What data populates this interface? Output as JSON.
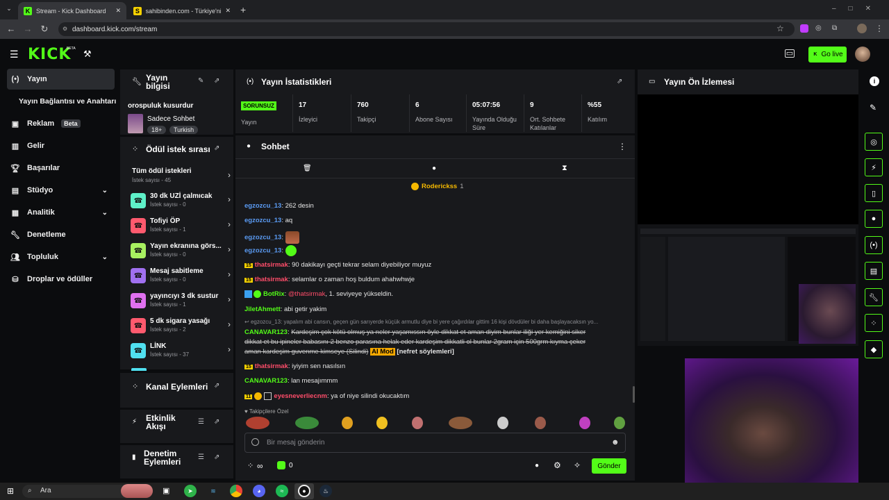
{
  "browser": {
    "tabs": [
      {
        "title": "Stream - Kick Dashboard"
      },
      {
        "title": "sahibinden.com - Türkiye'nin O"
      }
    ],
    "new_tab": "+",
    "url": "dashboard.kick.com/stream"
  },
  "header": {
    "logo": "KICK",
    "beta": "BETA",
    "go_live": "Go live"
  },
  "sidebar": {
    "items": [
      {
        "label": "Yayın",
        "icon": "broadcast-icon"
      },
      {
        "label": "Yayın Bağlantısı ve Anahtarı"
      },
      {
        "label": "Reklam",
        "badge": "Beta",
        "icon": "ad-icon"
      },
      {
        "label": "Gelir",
        "icon": "chart-icon"
      },
      {
        "label": "Başarılar",
        "icon": "trophy-icon"
      },
      {
        "label": "Stüdyo",
        "icon": "studio-icon"
      },
      {
        "label": "Analitik",
        "icon": "analytics-icon"
      },
      {
        "label": "Denetleme",
        "icon": "wrench-icon"
      },
      {
        "label": "Topluluk",
        "icon": "community-icon"
      },
      {
        "label": "Droplar ve ödüller",
        "icon": "drops-icon"
      }
    ]
  },
  "stream_info": {
    "title": "Yayın bilgisi",
    "stream_title": "orospuluk kusurdur",
    "category": "Sadece Sohbet",
    "tags": [
      "18+",
      "Turkish"
    ]
  },
  "rewards": {
    "title": "Ödül istek sırası",
    "all_title": "Tüm ödül istekleri",
    "all_count": "İstek sayısı - 45",
    "items": [
      {
        "title": "30 dk UZİ çalmıcak",
        "count": "İstek sayısı - 0",
        "color": "#5ef0c8"
      },
      {
        "title": "Tofiyi ÖP",
        "count": "İstek sayısı - 1",
        "color": "#ff5a6e"
      },
      {
        "title": "Yayın ekranına görs...",
        "count": "İstek sayısı - 0",
        "color": "#a8f060"
      },
      {
        "title": "Mesaj sabitleme",
        "count": "İstek sayısı - 0",
        "color": "#a070f0"
      },
      {
        "title": "yayıncıyı 3 dk sustur",
        "count": "İstek sayısı - 1",
        "color": "#e070f0"
      },
      {
        "title": "5 dk sigara yasağı",
        "count": "İstek sayısı - 2",
        "color": "#ff5a6e"
      },
      {
        "title": "LİNK",
        "count": "İstek sayısı - 37",
        "color": "#50e0f0"
      }
    ]
  },
  "channel_actions": {
    "title": "Kanal Eylemleri"
  },
  "activity": {
    "title": "Etkinlik Akışı"
  },
  "mod_actions": {
    "title": "Denetim Eylemleri"
  },
  "stats": {
    "title": "Yayın İstatistikleri",
    "items": [
      {
        "value": "SORUNSUZ",
        "label": "Yayın"
      },
      {
        "value": "17",
        "label": "İzleyici"
      },
      {
        "value": "760",
        "label": "Takipçi"
      },
      {
        "value": "6",
        "label": "Abone Sayısı"
      },
      {
        "value": "05:07:56",
        "label": "Yayında Olduğu Süre"
      },
      {
        "value": "9",
        "label": "Ort. Sohbete Katılanlar"
      },
      {
        "value": "%55",
        "label": "Katılım"
      }
    ]
  },
  "chat": {
    "title": "Sohbet",
    "pinned_user": "Roderickss",
    "pinned_count": "1",
    "reply_preview": "egzozcu_13: yapalım abi cansın, geçen gün sarıyerde küçük armutlu diye bi yere çağırdılar gittim 16 kişi dövdüler bi daha başlayacaksın yo...",
    "messages": [
      {
        "user": "egzozcu_13",
        "text": ": 262 desin"
      },
      {
        "user": "egzozcu_13",
        "text": ": aq"
      },
      {
        "user": "egzozcu_13",
        "text": ":"
      },
      {
        "user": "egzozcu_13",
        "text": ":"
      },
      {
        "badge": "15",
        "user": "thatsirmak",
        "text": ": 90 dakikayı geçti tekrar selam diyebiliyor muyuz"
      },
      {
        "badge": "15",
        "user": "thatsirmak",
        "text": ": selamlar o zaman hoş buldum ahahwhwje"
      },
      {
        "user": "BotRix",
        "mention": "@thatsirmak",
        "text": ", 1. seviyeye yükseldin."
      },
      {
        "user": "JiletAhmett",
        "text": ": abi getir yakim"
      },
      {
        "user": "CANAVAR123",
        "deleted_line1": "Kardeşim çok kötü olmuş ya neler yaşamıssın öyle dikkat et aman diyim bunlar iliği yer kemiğini siker",
        "deleted_line2": "dikkat et bu ipineler babasını 2 benzo parasına helak eder kardeşim dikkatli ol bunlar 2gram için 500grm kıyma çeker",
        "deleted_line3": "aman kardeşim guvenme kimseye (Silindi)",
        "ai_mod": "AI Mod",
        "ai_reason": "[nefret söylemleri]"
      },
      {
        "badge": "15",
        "user": "thatsirmak",
        "text": ": iyiyim sen nasılsın"
      },
      {
        "user": "CANAVAR123",
        "text": ": lan mesajımmm"
      },
      {
        "badge": "11",
        "user": "eyesneverliecnm",
        "text": ": ya of niye silindi okucaktım"
      }
    ],
    "emote_tray_label": "Takipçilere Özel",
    "input_placeholder": "Bir mesaj gönderin",
    "infinity": "∞",
    "points": "0",
    "send": "Gönder"
  },
  "preview": {
    "title": "Yayın Ön İzlemesi"
  },
  "taskbar": {
    "search": "Ara"
  }
}
